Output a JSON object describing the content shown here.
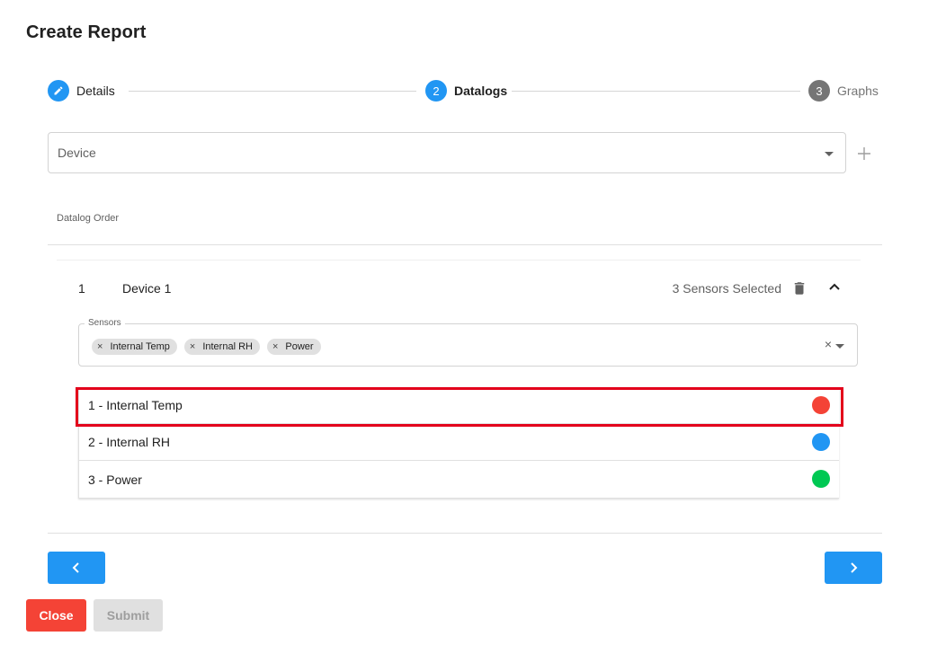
{
  "dialog": {
    "title": "Create Report"
  },
  "stepper": {
    "steps": [
      {
        "number": "",
        "label": "Details",
        "state": "completed"
      },
      {
        "number": "2",
        "label": "Datalogs",
        "state": "active"
      },
      {
        "number": "3",
        "label": "Graphs",
        "state": "pending"
      }
    ]
  },
  "device_select": {
    "placeholder": "Device"
  },
  "datalog_order": {
    "label": "Datalog Order",
    "rows": [
      {
        "index": "1",
        "device": "Device 1",
        "selected_text": "3 Sensors Selected",
        "sensors_label": "Sensors",
        "chips": [
          "Internal Temp",
          "Internal RH",
          "Power"
        ],
        "sensor_items": [
          {
            "label": "1 - Internal Temp",
            "color": "#f44336"
          },
          {
            "label": "2 - Internal RH",
            "color": "#2196f3"
          },
          {
            "label": "3 - Power",
            "color": "#00c853"
          }
        ]
      }
    ]
  },
  "chip_remove_glyph": "×",
  "clear_glyph": "×",
  "icons": {
    "step_completed": "pencil-icon",
    "add": "plus-icon",
    "delete": "trash-icon",
    "collapse": "chevron-up-icon",
    "prev": "chevron-left-icon",
    "next": "chevron-right-icon"
  },
  "colors": {
    "accent": "#2196f3",
    "danger": "#f44336",
    "highlight": "#e3001b"
  },
  "footer": {
    "close_label": "Close",
    "submit_label": "Submit"
  }
}
